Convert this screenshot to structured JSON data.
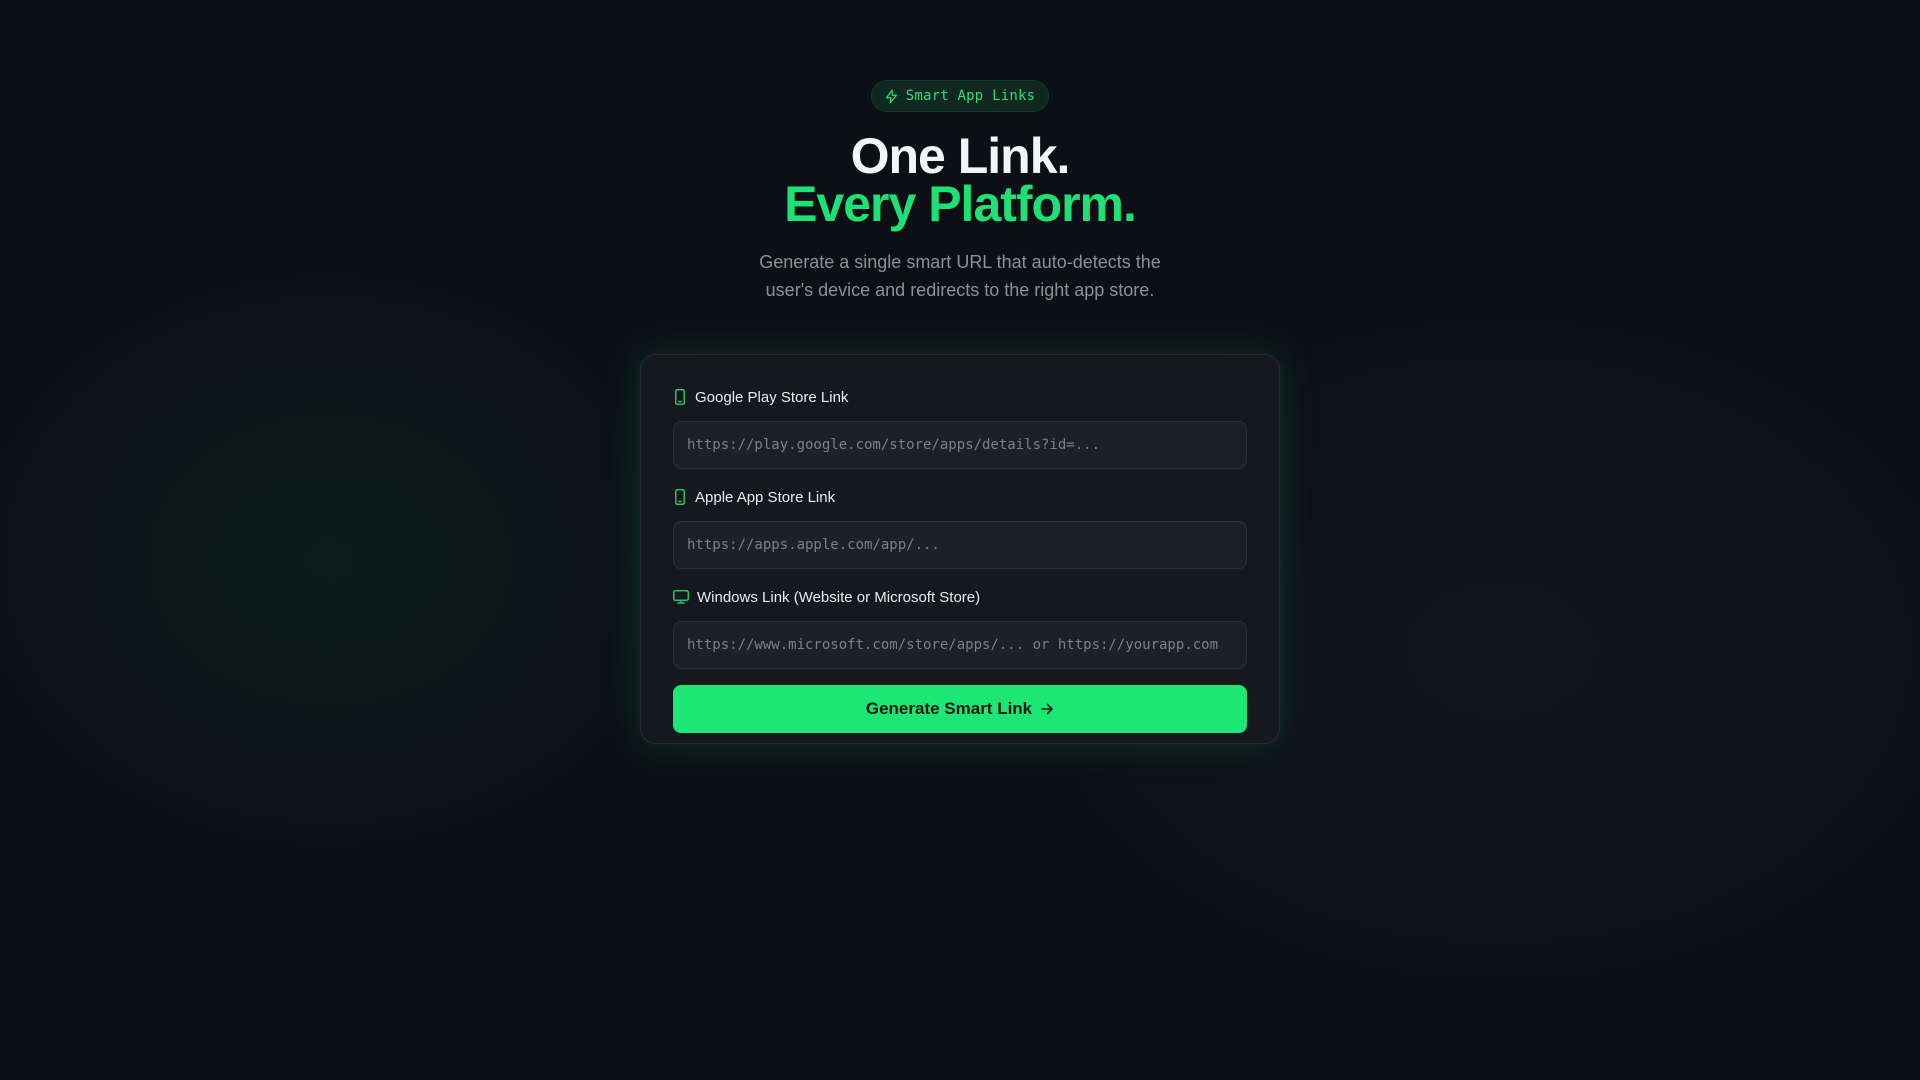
{
  "badge": {
    "icon": "lightning-icon",
    "label": "Smart App Links"
  },
  "hero": {
    "title_line1": "One Link.",
    "title_line2": "Every Platform.",
    "subtitle": "Generate a single smart URL that auto-detects the user's device and redirects to the right app store."
  },
  "form": {
    "fields": [
      {
        "icon": "smartphone-icon",
        "label": "Google Play Store Link",
        "value": "",
        "placeholder": "https://play.google.com/store/apps/details?id=..."
      },
      {
        "icon": "smartphone-icon",
        "label": "Apple App Store Link",
        "value": "",
        "placeholder": "https://apps.apple.com/app/..."
      },
      {
        "icon": "monitor-icon",
        "label": "Windows Link (Website or Microsoft Store)",
        "value": "",
        "placeholder": "https://www.microsoft.com/store/apps/... or https://yourapp.com"
      }
    ],
    "submit_label": "Generate Smart Link",
    "submit_icon": "arrow-right-icon"
  },
  "colors": {
    "background": "#0c1016",
    "accent": "#1de675",
    "card": "#15181f",
    "input": "#1d2027"
  }
}
